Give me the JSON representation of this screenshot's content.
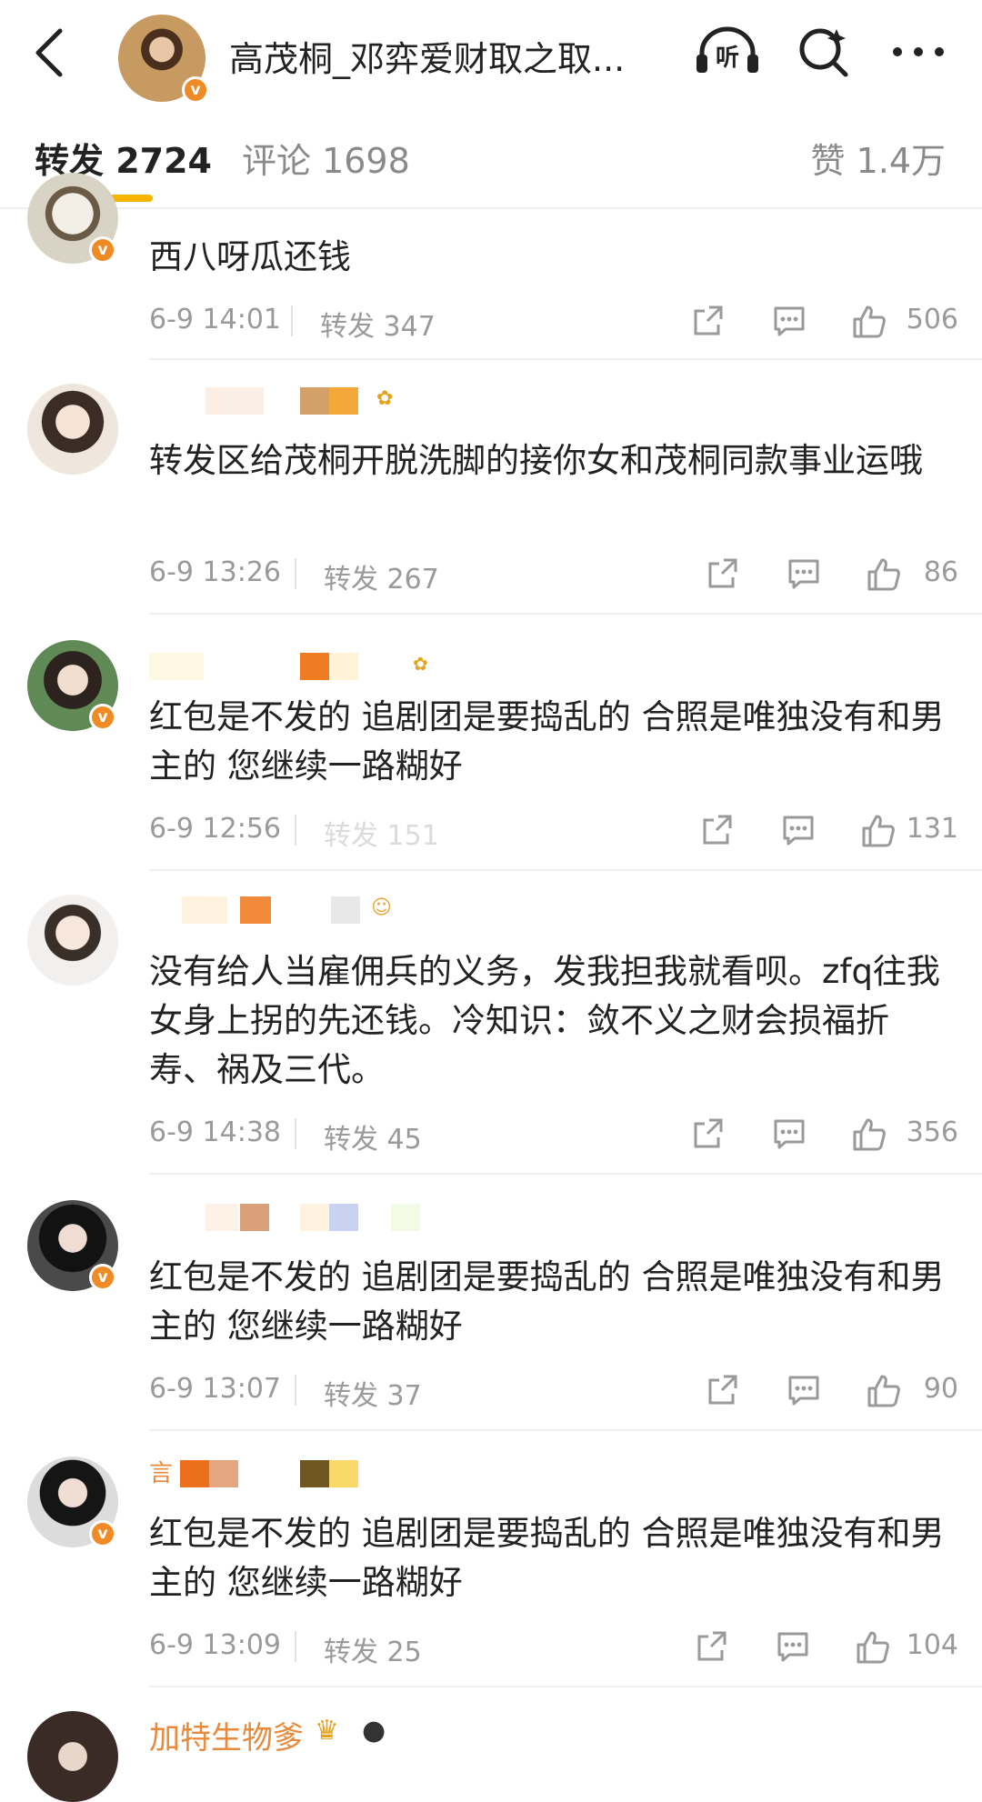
{
  "header": {
    "title": "高茂桐_邓弈爱财取之取...",
    "listen_icon_label": "听",
    "icons": [
      "back-icon",
      "listen-icon",
      "search-icon",
      "more-icon"
    ],
    "accent_color": "#f7b500",
    "badge_color": "#f08a24"
  },
  "tabs": {
    "repost": "转发 2724",
    "comments": "评论 1698",
    "likes": "赞 1.4万"
  },
  "items": [
    {
      "content": "西八呀瓜还钱",
      "time": "6-9 14:01",
      "reposts": "转发 347",
      "likes": "506"
    },
    {
      "content": "转发区给茂桐开脱洗脚的接你女和茂桐同款事业运哦",
      "time": "6-9 13:26",
      "reposts": "转发 267",
      "likes": "86"
    },
    {
      "content": "红包是不发的 追剧团是要捣乱的 合照是唯独没有和男主的 您继续一路糊好",
      "time": "6-9 12:56",
      "reposts": "转发 151",
      "likes": "131"
    },
    {
      "content": "没有给人当雇佣兵的义务，发我担我就看呗。zfq往我女身上拐的先还钱。冷知识：敛不义之财会损福折寿、祸及三代。",
      "time": "6-9 14:38",
      "reposts": "转发 45",
      "likes": "356"
    },
    {
      "content": "红包是不发的 追剧团是要捣乱的 合照是唯独没有和男主的 您继续一路糊好",
      "time": "6-9 13:07",
      "reposts": "转发 37",
      "likes": "90"
    },
    {
      "content": "红包是不发的 追剧团是要捣乱的 合照是唯独没有和男主的 您继续一路糊好",
      "time": "6-9 13:09",
      "reposts": "转发 25",
      "likes": "104"
    }
  ],
  "last_item": {
    "name": "加特生物爹"
  }
}
